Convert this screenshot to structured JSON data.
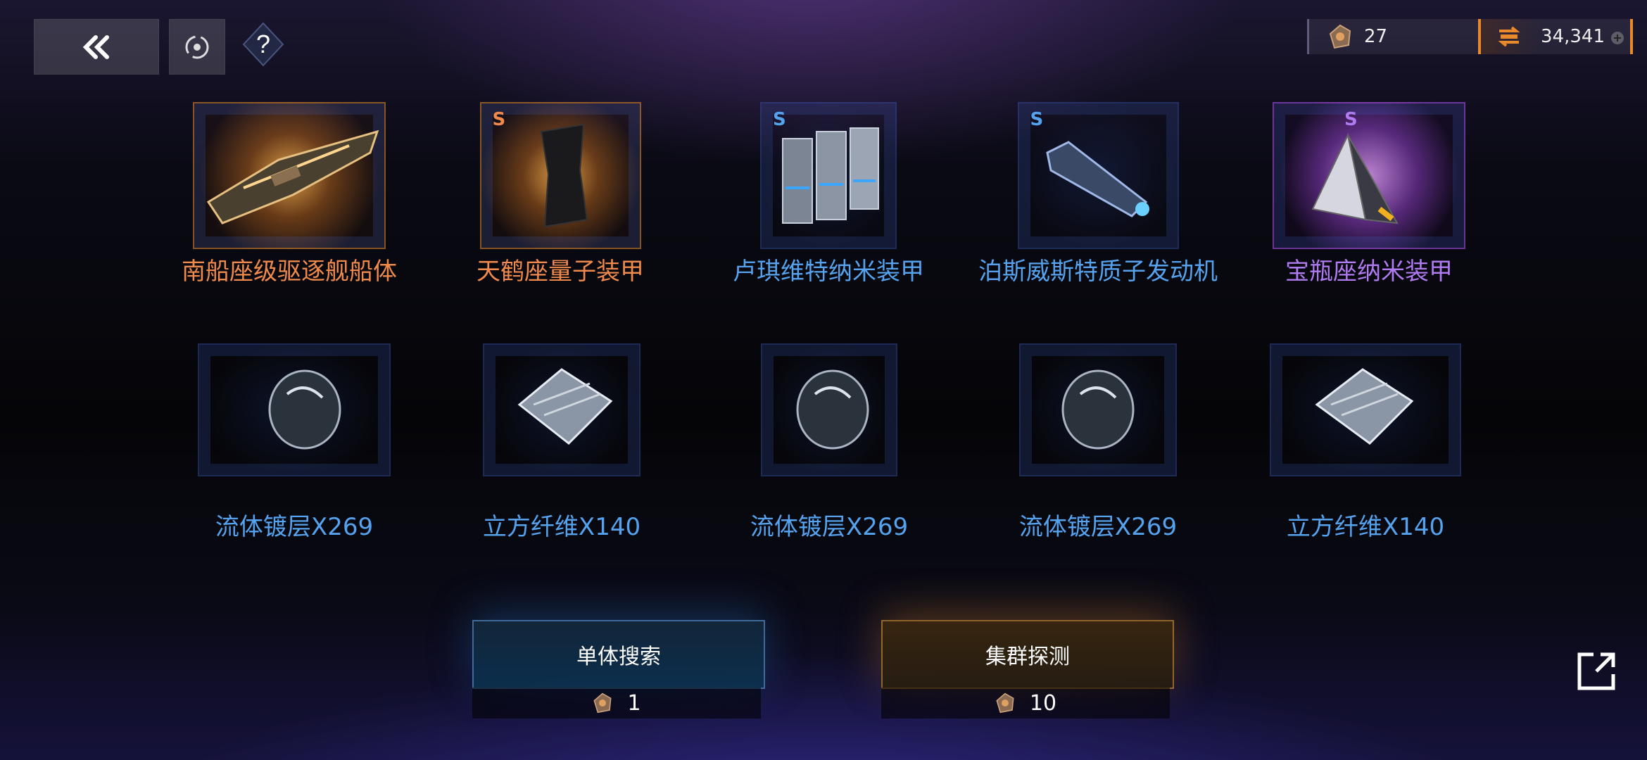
{
  "colors": {
    "orange": "#ef8a4c",
    "blue": "#55a3ee",
    "purple": "#b07af0",
    "accent": "#e88a2c"
  },
  "currencies": [
    {
      "icon": "token-icon",
      "value": "27"
    },
    {
      "icon": "credits-icon",
      "value": "34,341"
    }
  ],
  "rewards": [
    {
      "name": "南船座级驱逐舰船体",
      "tier": "",
      "color": "orange",
      "icon": "destroyer-hull-icon"
    },
    {
      "name": "天鹤座量子装甲",
      "tier": "S",
      "color": "orange",
      "icon": "quantum-armor-icon"
    },
    {
      "name": "卢琪维特纳米装甲",
      "tier": "S",
      "color": "blue",
      "icon": "nano-armor-icon"
    },
    {
      "name": "泊斯威斯特质子发动机",
      "tier": "S",
      "color": "blue",
      "icon": "proton-engine-icon"
    },
    {
      "name": "宝瓶座纳米装甲",
      "tier": "S",
      "color": "purple",
      "icon": "pyramid-armor-icon"
    }
  ],
  "materials": [
    {
      "name": "流体镀层X269",
      "icon": "fluid-coating-icon"
    },
    {
      "name": "立方纤维X140",
      "icon": "cubic-fiber-icon"
    },
    {
      "name": "流体镀层X269",
      "icon": "fluid-coating-icon"
    },
    {
      "name": "流体镀层X269",
      "icon": "fluid-coating-icon"
    },
    {
      "name": "立方纤维X140",
      "icon": "cubic-fiber-icon"
    }
  ],
  "actions": {
    "single_search": {
      "label": "单体搜索",
      "cost": "1"
    },
    "cluster_detect": {
      "label": "集群探测",
      "cost": "10"
    }
  }
}
